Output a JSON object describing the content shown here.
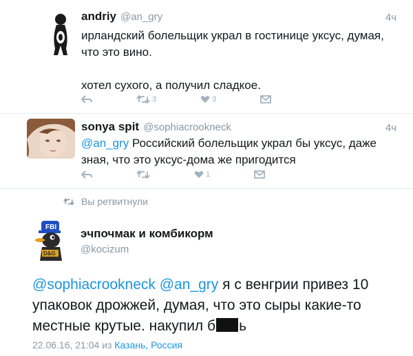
{
  "tweet1": {
    "name": "andriy",
    "handle": "@an_gry",
    "time": "4ч",
    "line1": "ирландский болельщик украл в гостинице уксус, думая,",
    "line2": "что это вино.",
    "line3": "хотел сухого, а получил сладкое.",
    "retweets": "3",
    "likes": "3"
  },
  "tweet2": {
    "name": "sonya spit",
    "handle": "@sophiacrookneck",
    "time": "4ч",
    "mention": "@an_gry",
    "line1_rest": " Российский болельщик украл бы уксус, даже",
    "line2": "зная, что это уксус-дома же пригодится",
    "likes": "1"
  },
  "retweet_banner": "Вы ретвитнули",
  "tweet3": {
    "name": "эчпочмак и комбикорм",
    "handle": "@kocizum",
    "mention1": "@sophiacrookneck",
    "mention2": "@an_gry",
    "text_a": " я с венгрии привез 10",
    "text_b": "упаковок дрожжей, думая, что это сыры какие-то",
    "text_c1": "местные крутые. накупил б",
    "text_c2": "ь",
    "date": "22.06.16, 21:04 из ",
    "location": "Казань, Россия"
  },
  "colors": {
    "accent": "#1b95e0",
    "muted": "#8899a6"
  },
  "icons": [
    "reply-icon",
    "retweet-icon",
    "like-icon",
    "message-icon"
  ]
}
